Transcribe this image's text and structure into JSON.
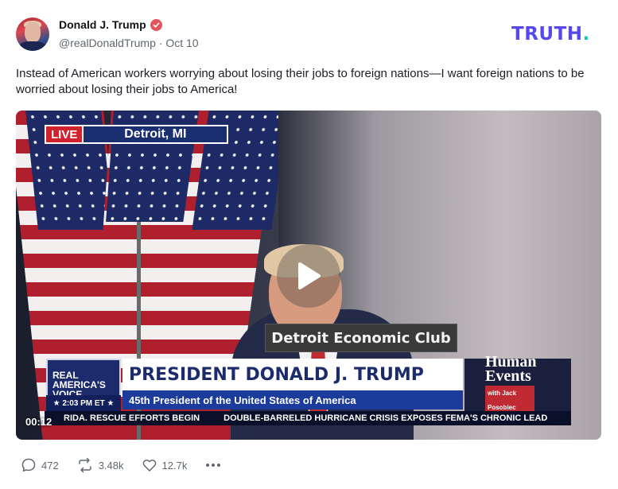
{
  "post": {
    "author": {
      "display_name": "Donald J. Trump",
      "handle": "@realDonaldTrump",
      "separator": "·",
      "date": "Oct 10",
      "verified_icon": "verified-badge-icon"
    },
    "brand": {
      "text": "TRUTH",
      "dot": "."
    },
    "text": "Instead of American workers worrying about losing their jobs to foreign nations—I want foreign nations to be worried about losing their jobs to America!",
    "video": {
      "timecode": "00:12",
      "live_label": "LIVE",
      "location": "Detroit, MI",
      "podium_sign": "Detroit Economic Club",
      "network_logo": [
        "REAL",
        "AMERICA'S",
        "VOICE"
      ],
      "broadcast_time": "★ 2:03 PM ET ★",
      "headline": "PRESIDENT DONALD J. TRUMP",
      "subheadline": "45th President of the United States of America",
      "show_brand": [
        "Human",
        "Events"
      ],
      "show_byline": "with Jack Posobiec",
      "ticker": [
        "RIDA. RESCUE EFFORTS BEGIN",
        "DOUBLE-BARRELED HURRICANE CRISIS EXPOSES FEMA'S CHRONIC LEAD"
      ],
      "play_icon": "play-icon"
    },
    "actions": {
      "replies": "472",
      "retruths": "3.48k",
      "likes": "12.7k",
      "more_icon": "more-horizontal-icon"
    }
  },
  "colors": {
    "brand_purple": "#5448ee",
    "brand_teal": "#17c7b5",
    "verified_red": "#e4545d",
    "muted_text": "#606770"
  }
}
